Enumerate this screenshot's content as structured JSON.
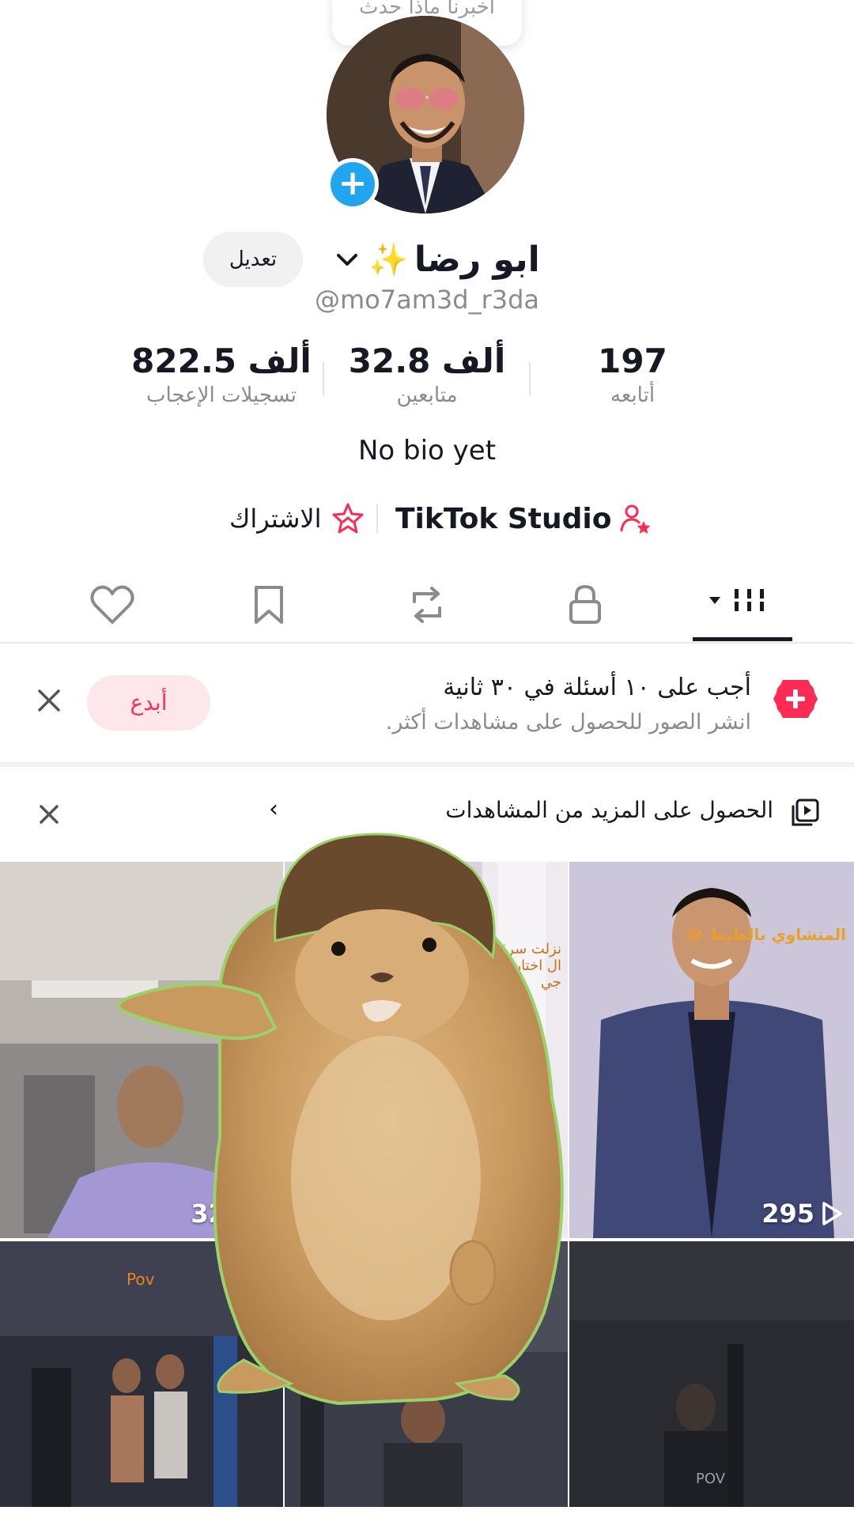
{
  "bubble": {
    "text": "أخبرنا ماذا حدث"
  },
  "profile": {
    "edit_label": "تعديل",
    "display_name": "ابو رضا",
    "username": "@mo7am3d_r3da",
    "bio": "No bio yet"
  },
  "stats": [
    {
      "value": "197",
      "label": "أتابعه"
    },
    {
      "value": "32.8 ألف",
      "label": "متابعين"
    },
    {
      "value": "822.5 ألف",
      "label": "تسجيلات الإعجاب"
    }
  ],
  "links": {
    "studio_label": "TikTok Studio",
    "subscribe_label": "الاشتراك"
  },
  "tabs": [
    "videos-grid-icon",
    "lock-icon",
    "repost-icon",
    "bookmark-icon",
    "heart-icon"
  ],
  "banner_quiz": {
    "title": "أجب على ١٠ أسئلة في ٣٠ ثانية",
    "subtitle": "انشر الصور للحصول على مشاهدات أكثر.",
    "button_label": "أبدع"
  },
  "banner_views": {
    "text": "الحصول على المزيد من المشاهدات"
  },
  "videos": [
    {
      "views": "329",
      "overlay_text": ""
    },
    {
      "views": "",
      "overlay_text": "نزلت سرق ال اختار ا جي"
    },
    {
      "views": "295",
      "overlay_text": "المتشاوي بالظبط 😂"
    },
    {
      "views": "",
      "overlay_text": "Pov"
    },
    {
      "views": "",
      "overlay_text": ""
    },
    {
      "views": "",
      "overlay_text": "POV"
    }
  ],
  "colors": {
    "accent": "#fe2c55",
    "link_blue": "#20a5ee",
    "text": "#161823",
    "muted": "#8a8b91"
  }
}
